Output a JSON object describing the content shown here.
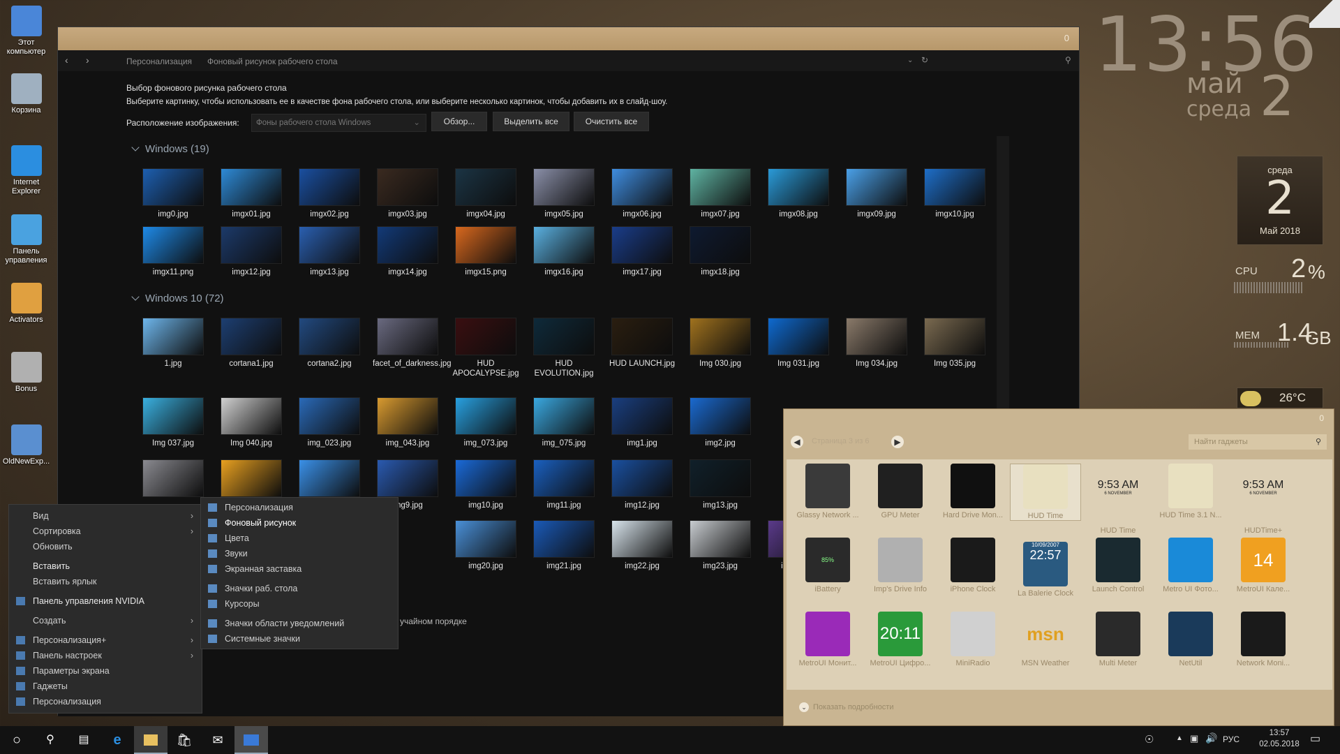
{
  "desktop": {
    "icons": [
      {
        "label": "Этот компьютер",
        "icon": "computer-icon",
        "color": "#4a86d8"
      },
      {
        "label": "Корзина",
        "icon": "recycle-bin-icon",
        "color": "#9fb0c0"
      },
      {
        "label": "Internet Explorer",
        "icon": "internet-explorer-icon",
        "color": "#2b8ee0"
      },
      {
        "label": "Панель управления",
        "icon": "control-panel-icon",
        "color": "#4aa2e0"
      },
      {
        "label": "Activators",
        "icon": "activators-icon",
        "color": "#e0a040"
      },
      {
        "label": "Bonus",
        "icon": "bonus-icon",
        "color": "#b0b0b0"
      },
      {
        "label": "OldNewExp...",
        "icon": "oldnewexplorer-icon",
        "color": "#5a8fd0"
      }
    ]
  },
  "window": {
    "title_counter": "0",
    "breadcrumb": [
      "Персонализация",
      "Фоновый рисунок рабочего стола"
    ],
    "heading": "Выбор фонового рисунка рабочего стола",
    "description": "Выберите картинку, чтобы использовать ее в качестве фона рабочего стола, или выберите несколько картинок, чтобы добавить их в слайд-шоу.",
    "location_label": "Расположение изображения:",
    "location_value": "Фоны рабочего стола Windows",
    "browse_button": "Обзор...",
    "select_all_button": "Выделить все",
    "clear_all_button": "Очистить все",
    "group1": "Windows (19)",
    "group2": "Windows 10 (72)",
    "random_order_text": "учайном порядке",
    "images_g1": [
      {
        "name": "img0.jpg",
        "color": "#1d5fb0"
      },
      {
        "name": "imgx01.jpg",
        "color": "#2e8ad6"
      },
      {
        "name": "imgx02.jpg",
        "color": "#1a4fa0"
      },
      {
        "name": "imgx03.jpg",
        "color": "#3a2a20"
      },
      {
        "name": "imgx04.jpg",
        "color": "#1b3444"
      },
      {
        "name": "imgx05.jpg",
        "color": "#8a8fa8"
      },
      {
        "name": "imgx06.jpg",
        "color": "#3f8de0"
      },
      {
        "name": "imgx07.jpg",
        "color": "#5fb3a2"
      },
      {
        "name": "imgx08.jpg",
        "color": "#2a9ad8"
      },
      {
        "name": "imgx09.jpg",
        "color": "#4aa0e8"
      },
      {
        "name": "imgx10.jpg",
        "color": "#1e6ec8"
      },
      {
        "name": "imgx11.png",
        "color": "#1e8ae8"
      },
      {
        "name": "imgx12.jpg",
        "color": "#1c3a6a"
      },
      {
        "name": "imgx13.jpg",
        "color": "#2a5fb0"
      },
      {
        "name": "imgx14.jpg",
        "color": "#123a78"
      },
      {
        "name": "imgx15.png",
        "color": "#d8681e"
      },
      {
        "name": "imgx16.jpg",
        "color": "#5ab0e0"
      },
      {
        "name": "imgx17.jpg",
        "color": "#1a3d8a"
      },
      {
        "name": "imgx18.jpg",
        "color": "#0e1a30"
      }
    ],
    "images_g2": [
      {
        "name": "1.jpg",
        "color": "#6eb6ec"
      },
      {
        "name": "cortana1.jpg",
        "color": "#1d3f72"
      },
      {
        "name": "cortana2.jpg",
        "color": "#224a80"
      },
      {
        "name": "facet_of_darkness.jpg",
        "color": "#6a6a80"
      },
      {
        "name": "HUD APOCALYPSE.jpg",
        "color": "#3a0e10"
      },
      {
        "name": "HUD EVOLUTION.jpg",
        "color": "#0e2a3a"
      },
      {
        "name": "HUD LAUNCH.jpg",
        "color": "#2a1e10"
      },
      {
        "name": "Img 030.jpg",
        "color": "#a0721e"
      },
      {
        "name": "Img 031.jpg",
        "color": "#0e6ad0"
      },
      {
        "name": "Img 034.jpg",
        "color": "#8a7a6a"
      },
      {
        "name": "Img 035.jpg",
        "color": "#7a6a50"
      },
      {
        "name": "Img 037.jpg",
        "color": "#3ab0e0"
      },
      {
        "name": "Img 040.jpg",
        "color": "#d0d0d0"
      },
      {
        "name": "img_023.jpg",
        "color": "#2a6ab8"
      },
      {
        "name": "img_043.jpg",
        "color": "#d89a30"
      },
      {
        "name": "img_073.jpg",
        "color": "#28a0e0"
      },
      {
        "name": "img_075.jpg",
        "color": "#3aa8e0"
      },
      {
        "name": "img1.jpg",
        "color": "#1a3f80"
      },
      {
        "name": "img2.jpg",
        "color": "#1a6ad0"
      },
      {
        "name": "",
        "color": "#8a8a90"
      },
      {
        "name": "",
        "color": "#e8a020"
      },
      {
        "name": "",
        "color": "#3a90e8"
      },
      {
        "name": "img9.jpg",
        "color": "#2a5ab0"
      },
      {
        "name": "img10.jpg",
        "color": "#1a6ad8"
      },
      {
        "name": "img11.jpg",
        "color": "#1a60c0"
      },
      {
        "name": "img12.jpg",
        "color": "#1a50a0"
      },
      {
        "name": "img13.jpg",
        "color": "#10202a"
      },
      {
        "name": "img20.jpg",
        "color": "#4a90d8"
      },
      {
        "name": "img21.jpg",
        "color": "#1a5ab8"
      },
      {
        "name": "img22.jpg",
        "color": "#d8e4ec"
      },
      {
        "name": "img23.jpg",
        "color": "#c8ccd0"
      },
      {
        "name": "img24.jpg",
        "color": "#5a3a8a"
      }
    ]
  },
  "context_menu": {
    "items": [
      {
        "label": "Вид",
        "arrow": true
      },
      {
        "label": "Сортировка",
        "arrow": true
      },
      {
        "label": "Обновить",
        "arrow": false
      },
      {
        "label": "Вставить",
        "arrow": false
      },
      {
        "label": "Вставить ярлык",
        "arrow": false
      },
      {
        "label": "Панель управления NVIDIA",
        "arrow": false,
        "icon": "nvidia-icon"
      },
      {
        "label": "Создать",
        "arrow": true
      },
      {
        "label": "Персонализация+",
        "arrow": true,
        "icon": "personalization-plus-icon"
      },
      {
        "label": "Панель настроек",
        "arrow": true,
        "icon": "settings-panel-icon"
      },
      {
        "label": "Параметры экрана",
        "arrow": false,
        "icon": "display-settings-icon"
      },
      {
        "label": "Гаджеты",
        "arrow": false,
        "icon": "gadgets-icon"
      },
      {
        "label": "Персонализация",
        "arrow": false,
        "icon": "personalization-icon"
      }
    ]
  },
  "submenu": {
    "items": [
      {
        "label": "Персонализация",
        "icon": "personalization-icon"
      },
      {
        "label": "Фоновый рисунок",
        "icon": "wallpaper-icon"
      },
      {
        "label": "Цвета",
        "icon": "colors-icon"
      },
      {
        "label": "Звуки",
        "icon": "sounds-icon"
      },
      {
        "label": "Экранная заставка",
        "icon": "screensaver-icon"
      },
      {
        "label": "Значки раб. стола",
        "icon": "desktop-icons-icon"
      },
      {
        "label": "Курсоры",
        "icon": "cursors-icon"
      },
      {
        "label": "Значки области уведомлений",
        "icon": "tray-icons-icon"
      },
      {
        "label": "Системные значки",
        "icon": "system-icons-icon"
      }
    ]
  },
  "gadgets": {
    "counter": "0",
    "page_text": "Страница 3 из 6",
    "search_placeholder": "Найти гаджеты",
    "details_label": "Показать подробности",
    "items": [
      {
        "label": "Glassy Network ...",
        "color": "#3a3a3a"
      },
      {
        "label": "GPU Meter",
        "color": "#202020"
      },
      {
        "label": "Hard Drive Mon...",
        "color": "#101010"
      },
      {
        "label": "HUD Time",
        "color": "#e8e0c0"
      },
      {
        "label": "HUD Time",
        "color": "#ffffff"
      },
      {
        "label": "HUD Time 3.1 N...",
        "color": "#e8e0c0"
      },
      {
        "label": "HUDTime+",
        "color": "#ffffff"
      },
      {
        "label": "iBattery",
        "color": "#2a2a2a"
      },
      {
        "label": "Imp's Drive Info",
        "color": "#b0b0b0"
      },
      {
        "label": "iPhone Clock",
        "color": "#1a1a1a"
      },
      {
        "label": "La Balerie Clock",
        "color": "#2a5a80"
      },
      {
        "label": "Launch Control",
        "color": "#1a2a30"
      },
      {
        "label": "Metro UI Фото...",
        "color": "#1a8ad8"
      },
      {
        "label": "MetroUI Кале...",
        "color": "#f0a020"
      },
      {
        "label": "MetroUI Монит...",
        "color": "#9a2ab8"
      },
      {
        "label": "MetroUI Цифро...",
        "color": "#2a9a3a"
      },
      {
        "label": "MiniRadio",
        "color": "#d0d0d0"
      },
      {
        "label": "MSN Weather",
        "color": "#e0a020"
      },
      {
        "label": "Multi Meter",
        "color": "#2a2a2a"
      },
      {
        "label": "NetUtil",
        "color": "#1a3a5a"
      },
      {
        "label": "Network Moni...",
        "color": "#1a1a1a"
      }
    ],
    "clock_text": "9:53 AM",
    "clock_date": "6 NOVEMBER",
    "metro_clock": "20:11",
    "metro_cal": "14",
    "msn_text": "msn",
    "battery_text": "85%",
    "balerie_date": "10/09/2007",
    "balerie_time": "22:57"
  },
  "widgets": {
    "time": "13:56",
    "month": "май",
    "day": "2",
    "weekday": "среда",
    "cal_weekday": "среда",
    "cal_day": "2",
    "cal_month": "Май 2018",
    "cpu_label": "CPU",
    "cpu_value": "2",
    "cpu_unit": "%",
    "mem_label": "MEM",
    "mem_value": "1.4",
    "mem_unit": "GB",
    "temp": "26°C"
  },
  "taskbar": {
    "lang": "РУС",
    "time": "13:57",
    "date": "02.05.2018"
  }
}
